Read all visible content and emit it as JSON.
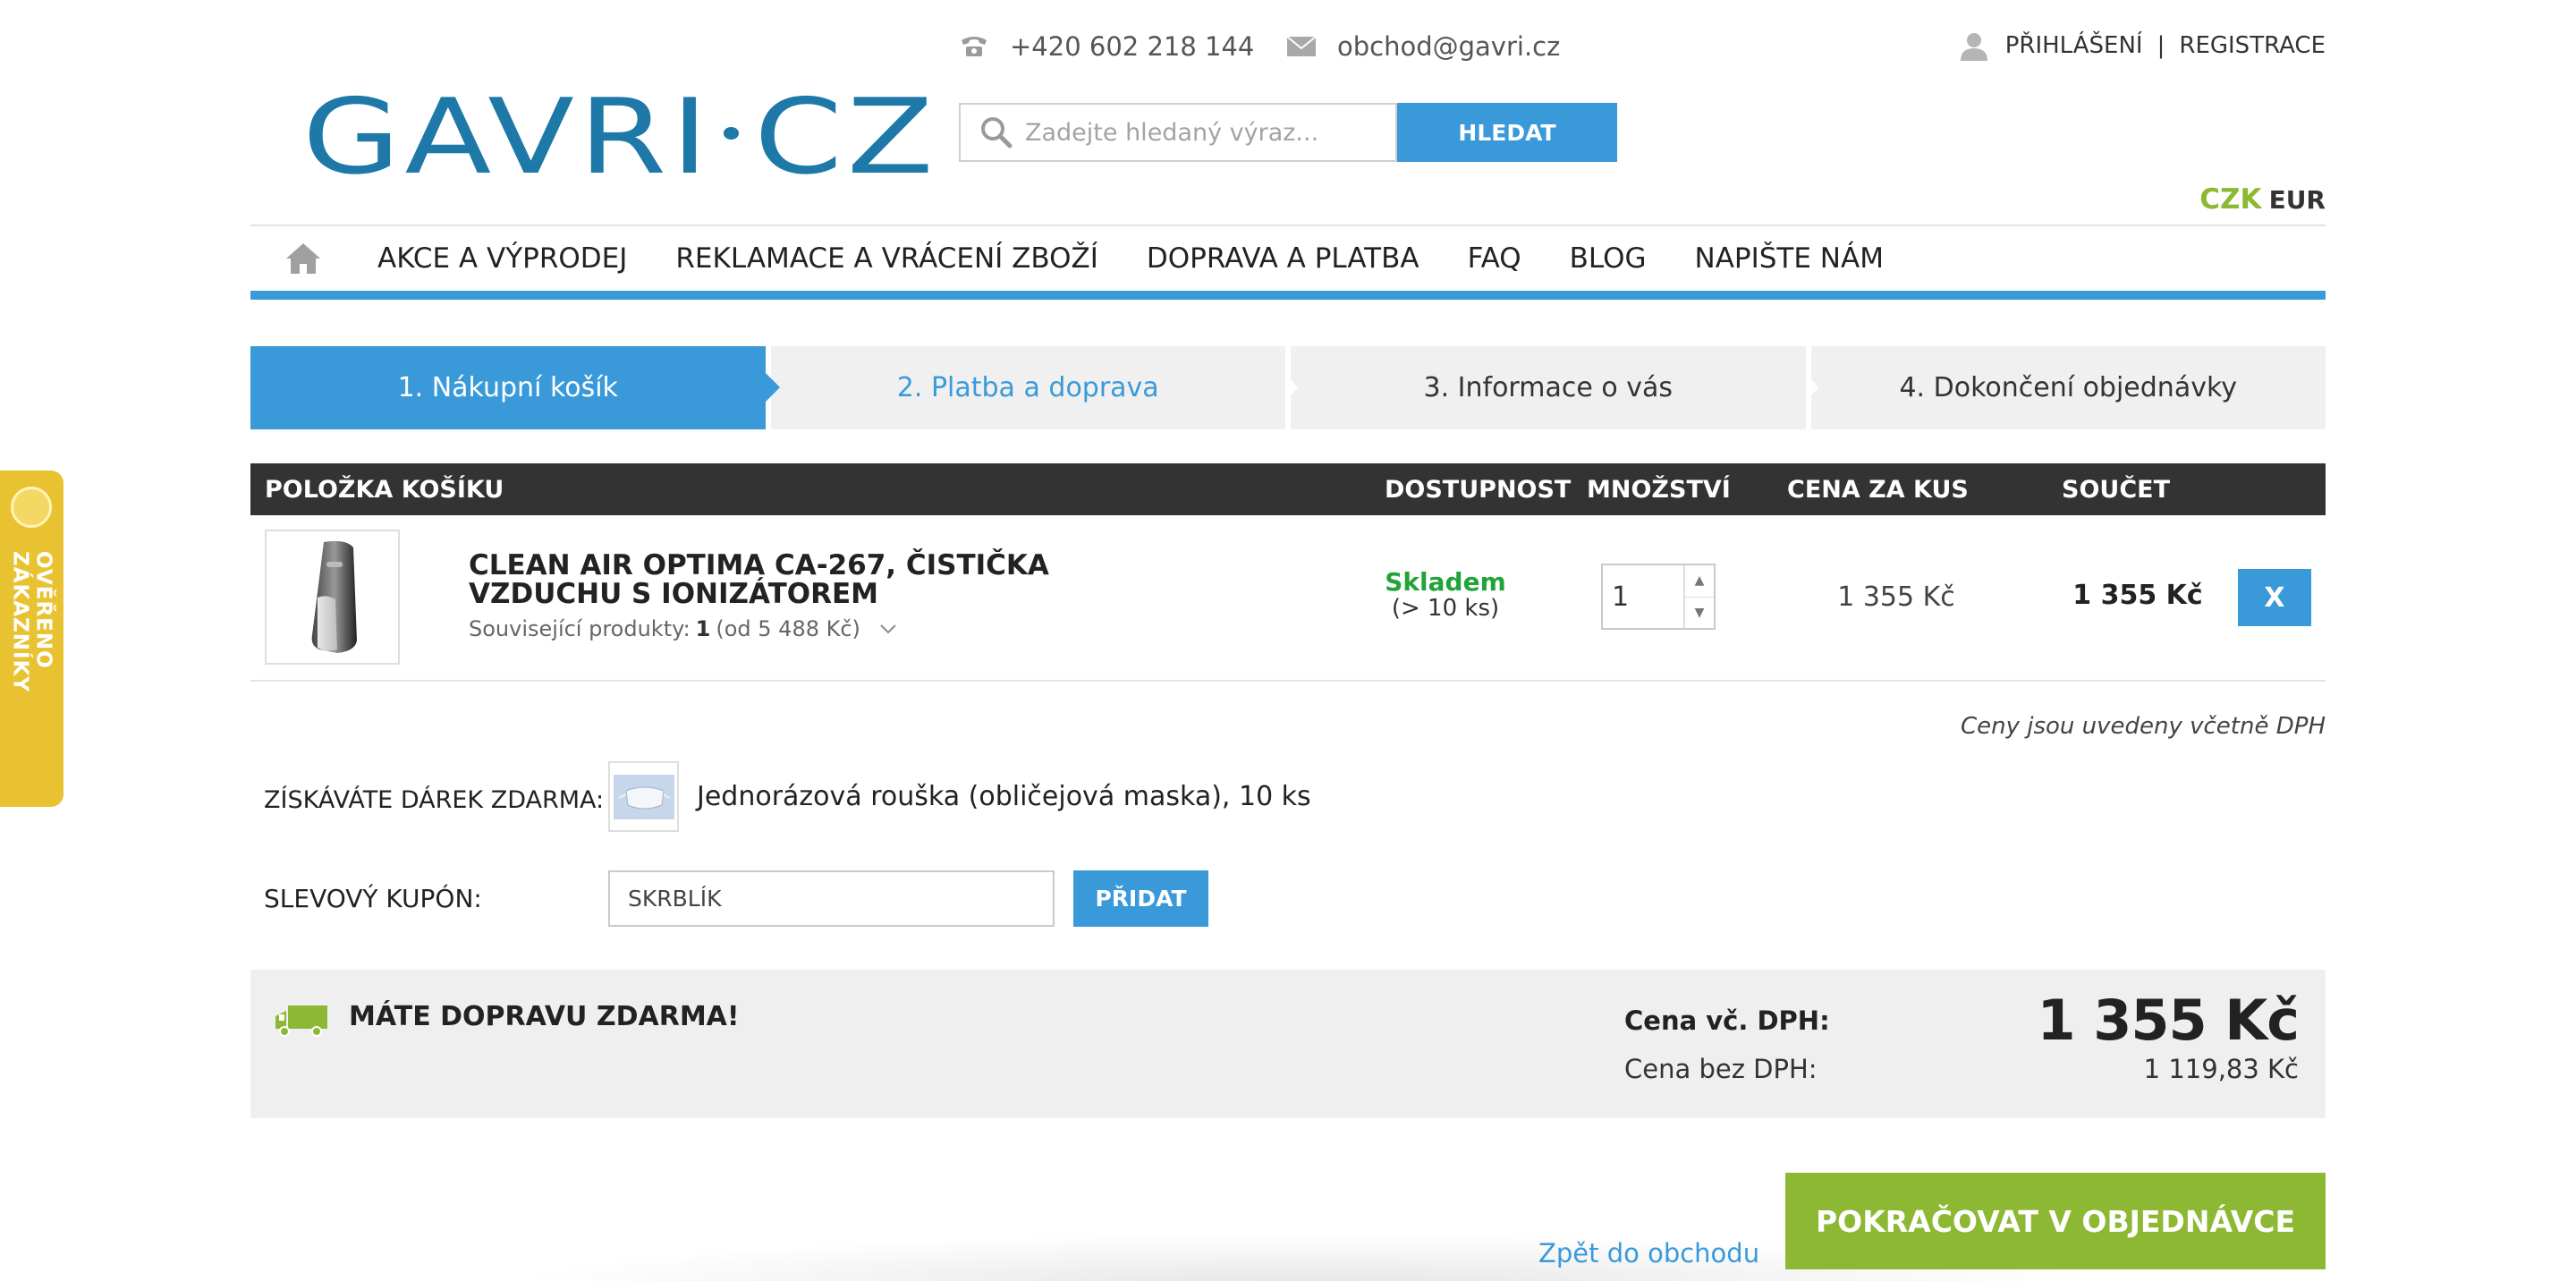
{
  "header": {
    "logo_left": "GAVRI",
    "logo_right": "CZ",
    "phone": "+420 602 218 144",
    "email": "obchod@gavri.cz",
    "login": "PŘIHLÁŠENÍ",
    "separator": "|",
    "register": "REGISTRACE",
    "search_placeholder": "Zadejte hledaný výraz...",
    "search_button": "HLEDAT",
    "currency_active": "CZK",
    "currency_other": "EUR"
  },
  "nav": {
    "items": [
      "AKCE A VÝPRODEJ",
      "REKLAMACE A VRÁCENÍ ZBOŽÍ",
      "DOPRAVA A PLATBA",
      "FAQ",
      "BLOG",
      "NAPIŠTE NÁM"
    ]
  },
  "steps": [
    "1. Nákupní košík",
    "2. Platba a doprava",
    "3. Informace o vás",
    "4. Dokončení objednávky"
  ],
  "cart": {
    "headers": {
      "item": "POLOŽKA KOŠÍKU",
      "availability": "DOSTUPNOST",
      "quantity": "MNOŽSTVÍ",
      "unit_price": "CENA ZA KUS",
      "total": "SOUČET"
    },
    "items": [
      {
        "name": "CLEAN AIR OPTIMA CA-267, ČISTIČKA VZDUCHU S IONIZÁTOREM",
        "related_label": "Související produkty:",
        "related_count": "1",
        "related_from": "(od 5 488 Kč)",
        "stock": "Skladem",
        "stock_count": "(> 10 ks)",
        "quantity": "1",
        "unit_price": "1 355 Kč",
        "total": "1 355 Kč",
        "remove": "X"
      }
    ],
    "vat_note": "Ceny jsou uvedeny včetně DPH"
  },
  "gift": {
    "label": "ZÍSKÁVÁTE DÁREK ZDARMA:",
    "name": "Jednorázová rouška (obličejová maska), 10 ks"
  },
  "coupon": {
    "label": "SLEVOVÝ KUPÓN:",
    "value": "SKRBLÍK",
    "button": "PŘIDAT"
  },
  "summary": {
    "free_shipping": "MÁTE DOPRAVU ZDARMA!",
    "price_with_vat_label": "Cena vč. DPH:",
    "price_with_vat": "1 355 Kč",
    "price_without_vat_label": "Cena bez DPH:",
    "price_without_vat": "1 119,83 Kč"
  },
  "actions": {
    "back": "Zpět do obchodu",
    "continue": "POKRAČOVAT V OBJEDNÁVCE"
  },
  "review_tab": "OVĚŘENO ZÁKAZNÍKY",
  "colors": {
    "primary_blue": "#3a9ad9",
    "logo_blue": "#1e78a8",
    "accent_green": "#8cb833",
    "stock_green": "#22a33a",
    "review_yellow": "#e9c232",
    "table_header": "#333333"
  }
}
